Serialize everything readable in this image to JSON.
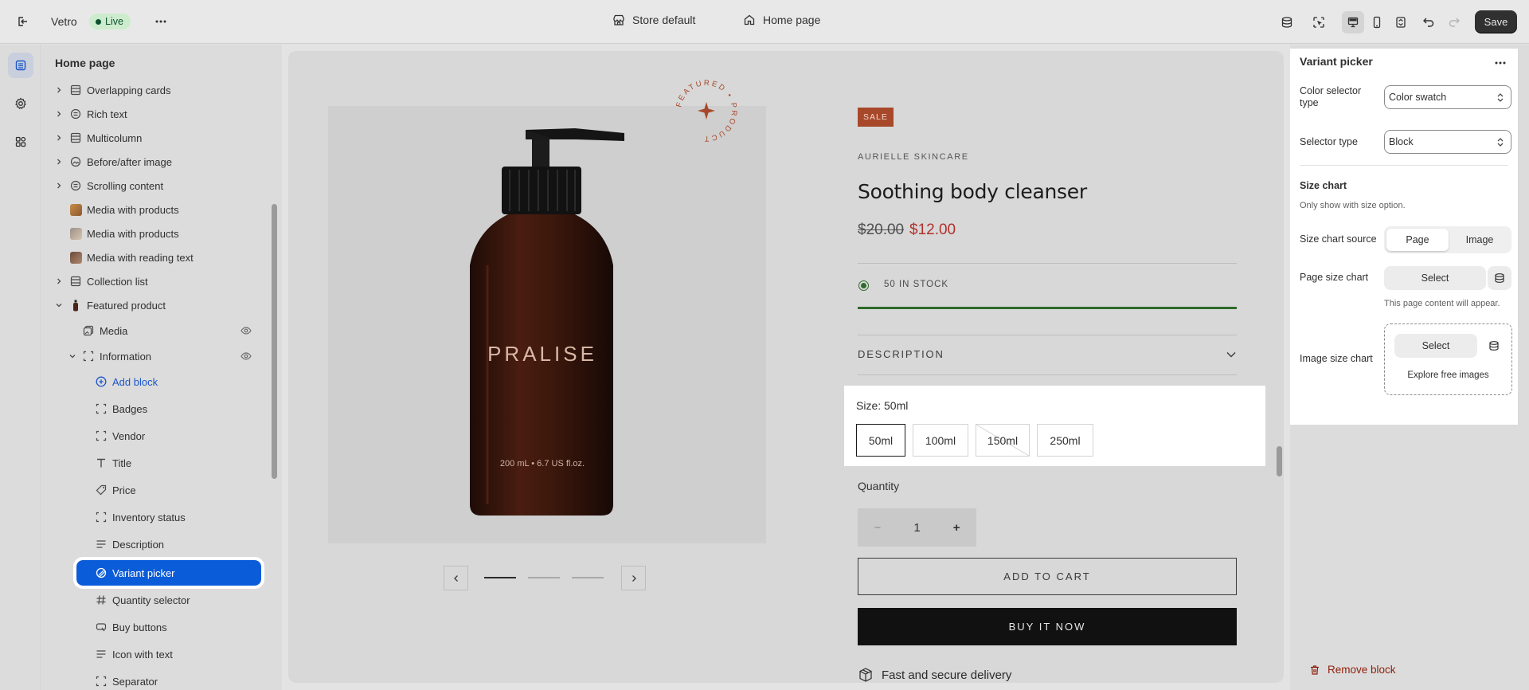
{
  "topbar": {
    "store_name": "Vetro",
    "status": "Live",
    "theme_selector": "Store default",
    "page_selector": "Home page",
    "save_label": "Save"
  },
  "sidebar": {
    "title": "Home page",
    "items": [
      {
        "label": "Overlapping cards",
        "icon": "section-icon",
        "expandable": true
      },
      {
        "label": "Rich text",
        "icon": "text-section-icon",
        "expandable": true
      },
      {
        "label": "Multicolumn",
        "icon": "section-icon",
        "expandable": true
      },
      {
        "label": "Before/after image",
        "icon": "image-compare-icon",
        "expandable": true
      },
      {
        "label": "Scrolling content",
        "icon": "text-section-icon",
        "expandable": true
      },
      {
        "label": "Media with products",
        "icon": "thumbnail",
        "expandable": false
      },
      {
        "label": "Media with products",
        "icon": "thumbnail",
        "expandable": false
      },
      {
        "label": "Media with reading text",
        "icon": "thumbnail",
        "expandable": false
      },
      {
        "label": "Collection list",
        "icon": "section-icon",
        "expandable": true
      },
      {
        "label": "Featured product",
        "icon": "product-thumbnail",
        "expandable": true,
        "expanded": true
      }
    ],
    "featured_children": [
      {
        "label": "Media",
        "icon": "media-icon"
      },
      {
        "label": "Information",
        "icon": "block-icon",
        "expanded": true
      }
    ],
    "add_block": "Add block",
    "blocks": [
      {
        "label": "Badges",
        "icon": "block-icon"
      },
      {
        "label": "Vendor",
        "icon": "block-icon"
      },
      {
        "label": "Title",
        "icon": "title-icon"
      },
      {
        "label": "Price",
        "icon": "price-tag-icon"
      },
      {
        "label": "Inventory status",
        "icon": "block-icon"
      },
      {
        "label": "Description",
        "icon": "lines-icon"
      },
      {
        "label": "Variant picker",
        "icon": "variant-icon",
        "selected": true
      },
      {
        "label": "Quantity selector",
        "icon": "hash-icon"
      },
      {
        "label": "Buy buttons",
        "icon": "buy-button-icon"
      },
      {
        "label": "Icon with text",
        "icon": "lines-icon"
      },
      {
        "label": "Separator",
        "icon": "block-icon"
      }
    ]
  },
  "preview": {
    "sale_badge": "SALE",
    "vendor": "AURIELLE SKINCARE",
    "title": "Soothing body cleanser",
    "price_compare": "$20.00",
    "price": "$12.00",
    "stock": "50 IN STOCK",
    "description_label": "DESCRIPTION",
    "bottle_brand": "PRALISE",
    "bottle_volume": "200 mL • 6.7 US fl.oz.",
    "badge_text": "FEATURED • PRODUCT",
    "size_label": "Size:",
    "size_value": "50ml",
    "sizes": [
      "50ml",
      "100ml",
      "150ml",
      "250ml"
    ],
    "selected_size": "50ml",
    "unavailable_size": "150ml",
    "quantity_label": "Quantity",
    "quantity": "1",
    "add_to_cart": "ADD TO CART",
    "buy_now": "BUY IT NOW",
    "delivery": "Fast and secure delivery"
  },
  "panel": {
    "title": "Variant picker",
    "color_selector_label": "Color selector type",
    "color_selector_value": "Color swatch",
    "selector_type_label": "Selector type",
    "selector_type_value": "Block",
    "size_chart_heading": "Size chart",
    "size_chart_note": "Only show with size option.",
    "size_chart_source_label": "Size chart source",
    "source_options": [
      "Page",
      "Image"
    ],
    "source_selected": "Page",
    "page_size_chart_label": "Page size chart",
    "select_label": "Select",
    "page_help": "This page content will appear.",
    "image_size_chart_label": "Image size chart",
    "explore": "Explore free images",
    "remove": "Remove block"
  },
  "colors": {
    "accent": "#0b5cd9",
    "sale": "#b0322c",
    "stock": "#2f6b2c",
    "remove": "#8e1f0b"
  }
}
